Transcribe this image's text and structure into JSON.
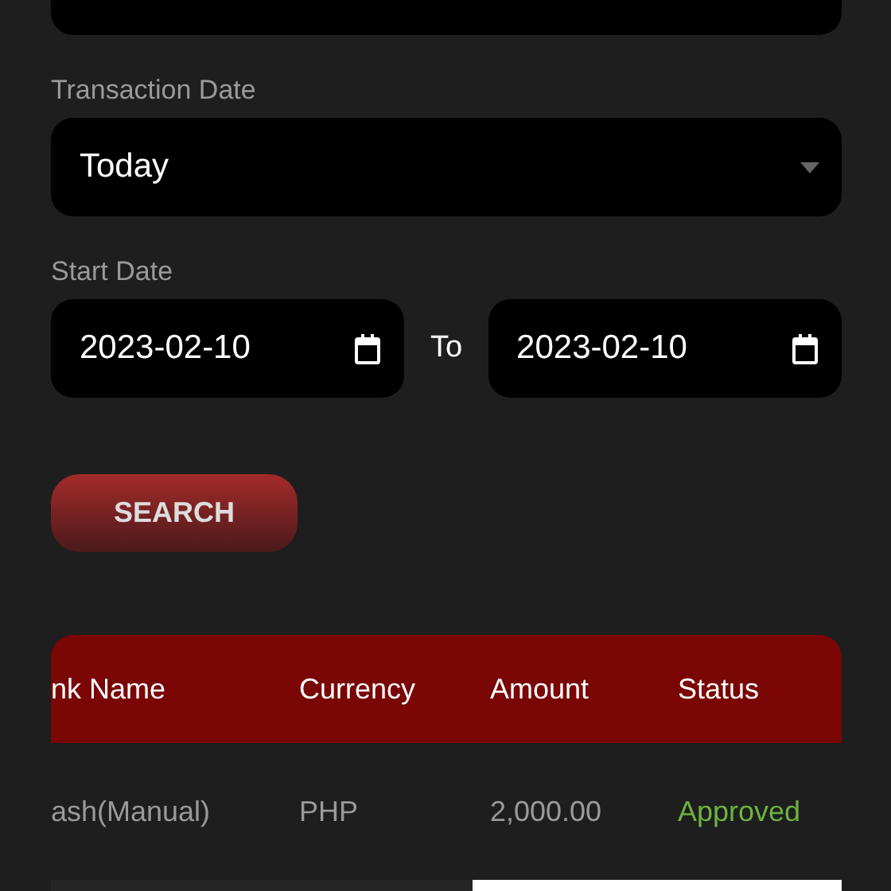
{
  "transaction_date": {
    "label": "Transaction Date",
    "value": "Today"
  },
  "date_range": {
    "label": "Start Date",
    "start": "2023-02-10",
    "separator": "To",
    "end": "2023-02-10"
  },
  "search_button": "SEARCH",
  "table": {
    "columns": [
      "nk Name",
      "Currency",
      "Amount",
      "Status"
    ],
    "rows": [
      {
        "cells": [
          "ash(Manual)",
          "PHP",
          "2,000.00",
          "Approved"
        ],
        "color": "#6cb33f"
      }
    ]
  }
}
